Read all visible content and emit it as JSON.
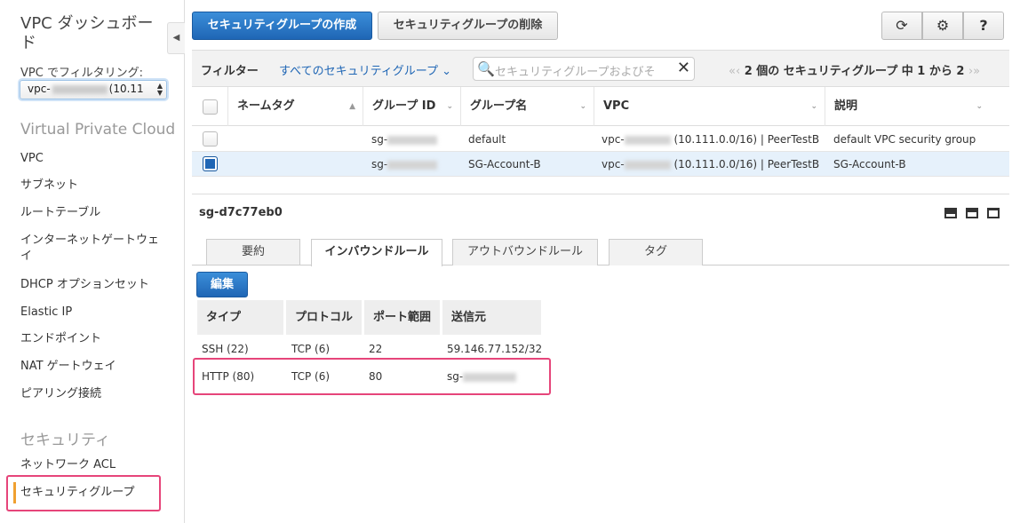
{
  "sidebar": {
    "title": "VPC ダッシュボード",
    "filter_label": "VPC でフィルタリング:",
    "filter_select_prefix": "vpc-",
    "filter_select_suffix": "(10.11",
    "section_vpc": "Virtual Private Cloud",
    "items": [
      "VPC",
      "サブネット",
      "ルートテーブル",
      "インターネットゲートウェイ",
      "DHCP オプションセット",
      "Elastic IP",
      "エンドポイント",
      "NAT ゲートウェイ",
      "ピアリング接続"
    ],
    "section_security": "セキュリティ",
    "security_items": [
      "ネットワーク ACL",
      "セキュリティグループ"
    ],
    "collapse_icon": "◀"
  },
  "toolbar": {
    "create_label": "セキュリティグループの作成",
    "delete_label": "セキュリティグループの削除",
    "refresh_icon": "⟳",
    "gear_icon": "⚙",
    "help_icon": "?"
  },
  "filter": {
    "label": "フィルター",
    "dropdown": "すべてのセキュリティグループ ⌄",
    "search_placeholder": "セキュリティグループおよびそ",
    "search_icon": "🔍",
    "clear_icon": "✕",
    "pager_prev": "«‹",
    "pager_text": "2 個の セキュリティグループ 中 1 から 2",
    "pager_next": "›»"
  },
  "table": {
    "columns": [
      "ネームタグ",
      "グループ ID",
      "グループ名",
      "VPC",
      "説明"
    ],
    "sort_icons": [
      "▲",
      "⌄",
      "⌄",
      "⌄",
      "⌄"
    ],
    "rows": [
      {
        "group_id": "sg-",
        "group_name": "default",
        "vpc_prefix": "vpc-",
        "vpc_suffix": "(10.111.0.0/16) | PeerTestB",
        "description": "default VPC security group"
      },
      {
        "group_id": "sg-",
        "group_name": "SG-Account-B",
        "vpc_prefix": "vpc-",
        "vpc_suffix": "(10.111.0.0/16) | PeerTestB",
        "description": "SG-Account-B"
      }
    ]
  },
  "detail": {
    "title": "sg-d7c77eb0",
    "tabs": [
      "要約",
      "インバウンドルール",
      "アウトバウンドルール",
      "タグ"
    ],
    "edit_label": "編集",
    "rule_columns": [
      "タイプ",
      "プロトコル",
      "ポート範囲",
      "送信元"
    ],
    "rules": [
      {
        "type": "SSH (22)",
        "protocol": "TCP (6)",
        "port": "22",
        "source": "59.146.77.152/32"
      },
      {
        "type": "HTTP (80)",
        "protocol": "TCP (6)",
        "port": "80",
        "source": "sg-"
      }
    ]
  },
  "colors": {
    "primary": "#1f66b5",
    "highlight": "#e6457a",
    "active_bar": "#f0a030"
  }
}
